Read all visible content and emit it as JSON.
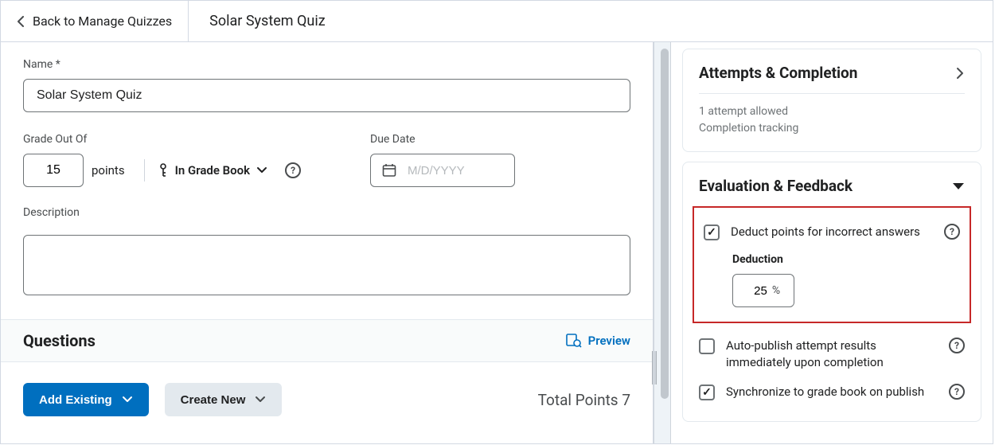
{
  "topbar": {
    "back_label": "Back to Manage Quizzes",
    "title": "Solar System Quiz"
  },
  "form": {
    "name_label": "Name *",
    "name_value": "Solar System Quiz",
    "grade_label": "Grade Out Of",
    "points_value": "15",
    "points_unit": "points",
    "gradebook_label": "In Grade Book",
    "due_label": "Due Date",
    "due_placeholder": "M/D/YYYY",
    "desc_label": "Description",
    "desc_value": ""
  },
  "questions": {
    "heading": "Questions",
    "preview_label": "Preview",
    "add_existing_label": "Add Existing",
    "create_new_label": "Create New",
    "total_points_label": "Total Points 7"
  },
  "right": {
    "attempts": {
      "title": "Attempts & Completion",
      "line1": "1 attempt allowed",
      "line2": "Completion tracking"
    },
    "eval": {
      "title": "Evaluation & Feedback",
      "deduct_label": "Deduct points for incorrect answers",
      "deduction_heading": "Deduction",
      "deduction_value": "25",
      "percent": "%",
      "autopub_label": "Auto-publish attempt results immediately upon completion",
      "sync_label": "Synchronize to grade book on publish"
    }
  }
}
